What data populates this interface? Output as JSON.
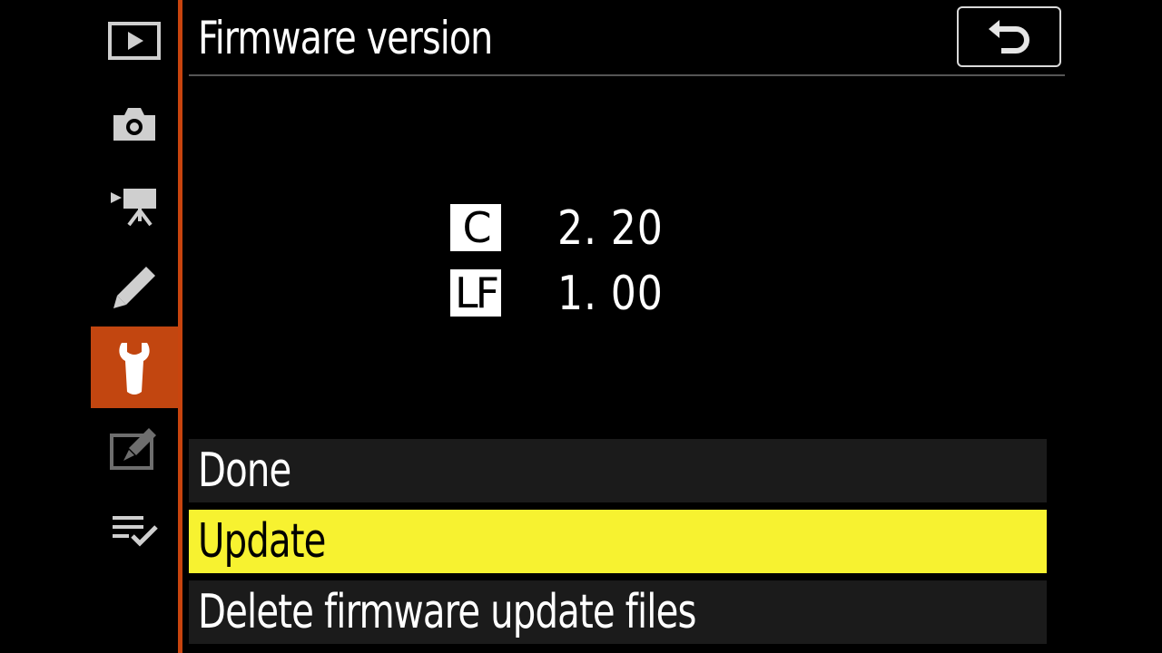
{
  "header": {
    "title": "Firmware version"
  },
  "sidebar": {
    "items": [
      {
        "icon": "playback-icon",
        "active": false
      },
      {
        "icon": "camera-icon",
        "active": false
      },
      {
        "icon": "movie-icon",
        "active": false
      },
      {
        "icon": "pencil-icon",
        "active": false
      },
      {
        "icon": "wrench-icon",
        "active": true
      },
      {
        "icon": "retouch-icon",
        "active": false
      },
      {
        "icon": "my-menu-icon",
        "active": false
      }
    ]
  },
  "versions": [
    {
      "label": "C",
      "value": "2. 20"
    },
    {
      "label": "LF",
      "value": "1. 00"
    }
  ],
  "menu": {
    "items": [
      {
        "label": "Done",
        "selected": false
      },
      {
        "label": "Update",
        "selected": true
      },
      {
        "label": "Delete firmware update files",
        "selected": false
      }
    ]
  },
  "colors": {
    "accent": "#c24610",
    "highlight": "#f7f230",
    "background": "#000000"
  }
}
